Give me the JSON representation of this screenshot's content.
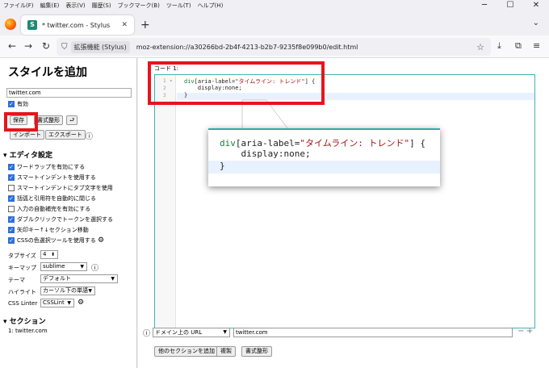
{
  "menubar": [
    "ファイル(F)",
    "編集(E)",
    "表示(V)",
    "履歴(S)",
    "ブックマーク(B)",
    "ツール(T)",
    "ヘルプ(H)"
  ],
  "tab": {
    "favicon": "S",
    "title": "* twitter.com - Stylus"
  },
  "navbar": {
    "extension_label": "拡張機能 (Stylus)",
    "url": "moz-extension://a30266bd-2b4f-4213-b2b7-9235f8e099b0/edit.html"
  },
  "sidebar": {
    "title": "スタイルを追加",
    "name_value": "twitter.com",
    "enabled_label": "有効",
    "save_label": "保存",
    "format_label": "書式整形",
    "undo_symbol": "⮐",
    "import_label": "インポート",
    "export_label": "エクスポート",
    "editor_settings_title": "エディタ設定",
    "options": [
      {
        "label": "ワードラップを有効にする",
        "checked": true
      },
      {
        "label": "スマートインデントを使用する",
        "checked": true
      },
      {
        "label": "スマートインデントにタブ文字を使用",
        "checked": false
      },
      {
        "label": "括弧と引用符を自動的に閉じる",
        "checked": true
      },
      {
        "label": "入力の自動補完を有効にする",
        "checked": false
      },
      {
        "label": "ダブルクリックでトークンを選択する",
        "checked": true
      },
      {
        "label": "矢印キー↑↓セクション移動",
        "checked": true
      },
      {
        "label": "CSSの色選択ツールを使用する",
        "checked": true
      }
    ],
    "tabsize_label": "タブサイズ",
    "tabsize_value": "4",
    "keymap_label": "キーマップ",
    "keymap_value": "sublime",
    "theme_label": "テーマ",
    "theme_value": "デフォルト",
    "highlight_label": "ハイライト",
    "highlight_value": "カーソル下の単語",
    "linter_label": "CSS Linter",
    "linter_value": "CSSLint",
    "sections_title": "セクション",
    "section_item": "1: twitter.com"
  },
  "editor": {
    "code_label": "コード 1:",
    "lines": [
      {
        "num": "1",
        "sel": "div",
        "rest": "[aria-label=",
        "str": "\"タイムライン: トレンド\"",
        "end": "] {"
      },
      {
        "num": "2",
        "text": "    display:none;"
      },
      {
        "num": "3",
        "text": "}"
      }
    ]
  },
  "callout": {
    "line1_sel": "div",
    "line1_rest": "[aria-label=",
    "line1_str": "\"タイムライン: トレンド\"",
    "line1_end": "] {",
    "line2": "    display:none;",
    "line3": "}"
  },
  "bottom": {
    "applies_type": "ドメイン上の URL",
    "applies_value": "twitter.com",
    "add_section_label": "他のセクションを追加",
    "clone_label": "複製",
    "format_label": "書式整形"
  },
  "colors": {
    "accent": "#2fa9a9",
    "highlight_box": "#e8141c"
  }
}
